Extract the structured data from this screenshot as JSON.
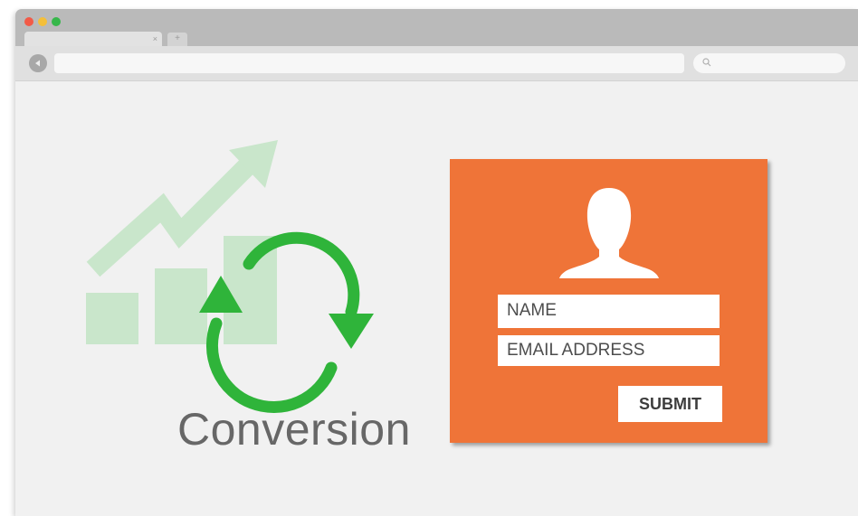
{
  "browser": {
    "traffic_lights": [
      "#f25a47",
      "#f4bf3a",
      "#36b74a"
    ],
    "tab_close": "×",
    "new_tab": "+",
    "icons": [
      "back-arrow-icon",
      "search-icon"
    ]
  },
  "hero": {
    "label": "Conversion",
    "growth_color": "#c9e6cb",
    "cycle_color": "#2fb43a"
  },
  "form": {
    "background": "#ef7438",
    "icon": "user-silhouette-icon",
    "name_placeholder": "NAME",
    "email_placeholder": "EMAIL ADDRESS",
    "submit_label": "SUBMIT"
  }
}
